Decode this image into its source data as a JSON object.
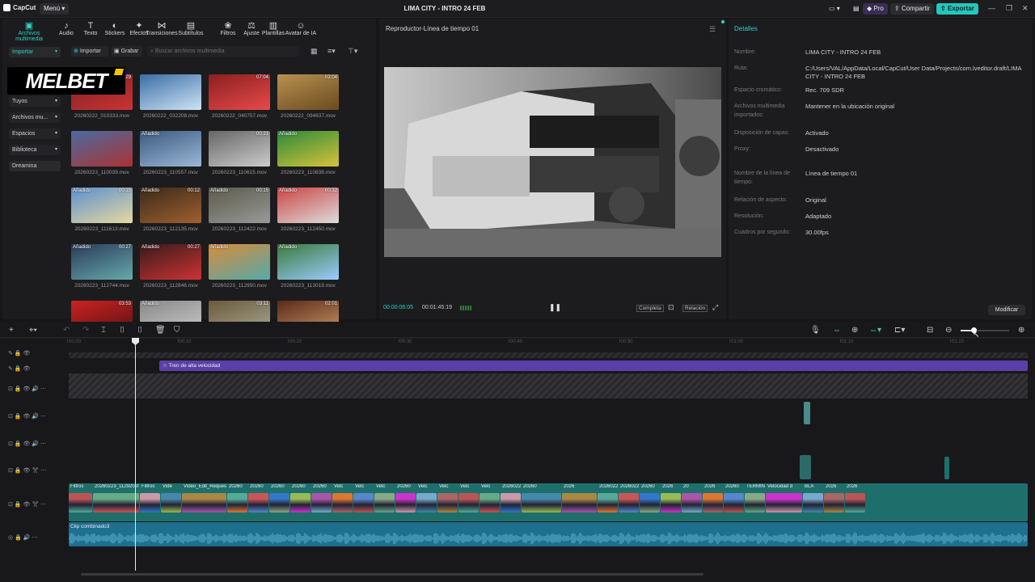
{
  "app": {
    "name": "CapCut",
    "menu_label": "Menú",
    "project_title": "LIMA CITY - INTRO 24 FEB",
    "pro_label": "Pro",
    "share_label": "Compartir",
    "export_label": "Exportar"
  },
  "toolbar": [
    {
      "label": "Archivos multimedia",
      "icon": "media-icon"
    },
    {
      "label": "Audio",
      "icon": "audio-icon"
    },
    {
      "label": "Texto",
      "icon": "text-icon"
    },
    {
      "label": "Stickers",
      "icon": "sticker-icon"
    },
    {
      "label": "Efectos",
      "icon": "effects-icon"
    },
    {
      "label": "Transiciones",
      "icon": "transitions-icon"
    },
    {
      "label": "Subtítulos",
      "icon": "subtitles-icon"
    },
    {
      "label": "Filtros",
      "icon": "filters-icon"
    },
    {
      "label": "Ajuste",
      "icon": "adjust-icon"
    },
    {
      "label": "Plantillas",
      "icon": "templates-icon"
    },
    {
      "label": "Avatar de IA",
      "icon": "ai-avatar-icon"
    }
  ],
  "media": {
    "import_side": "Importar",
    "import_btn": "Importar",
    "record_btn": "Grabar",
    "search_placeholder": "Buscar archivos multimedia",
    "overlay_logo": "MELBET",
    "sidebar": [
      "Tuyos",
      "Archivos mu...",
      "Espacios",
      "Biblioteca",
      "Dreamina"
    ],
    "clips": [
      {
        "name": "20260222_010333.mov",
        "tag": "",
        "dur": ":29"
      },
      {
        "name": "20260222_032208.mov",
        "tag": "",
        "dur": ""
      },
      {
        "name": "20260222_040757.mov",
        "tag": "",
        "dur": "07:04"
      },
      {
        "name": "20260222_094637.mov",
        "tag": "",
        "dur": "02:04"
      },
      {
        "name": "20260223_110039.mov",
        "tag": "",
        "dur": ""
      },
      {
        "name": "20260223_110557.mov",
        "tag": "Añadido",
        "dur": ""
      },
      {
        "name": "20260223_110615.mov",
        "tag": "",
        "dur": "00:21"
      },
      {
        "name": "20260223_110838.mov",
        "tag": "Añadido",
        "dur": ""
      },
      {
        "name": "20260223_111613.mov",
        "tag": "Añadido",
        "dur": "00:15"
      },
      {
        "name": "20260223_112135.mov",
        "tag": "Añadido",
        "dur": "00:12"
      },
      {
        "name": "20260223_112422.mov",
        "tag": "Añadido",
        "dur": "00:15"
      },
      {
        "name": "20260223_112450.mov",
        "tag": "Añadido",
        "dur": "00:32"
      },
      {
        "name": "20260223_112744.mov",
        "tag": "Añadido",
        "dur": "00:27"
      },
      {
        "name": "20260223_112846.mov",
        "tag": "Añadido",
        "dur": "00:27"
      },
      {
        "name": "20260223_112950.mov",
        "tag": "Añadido",
        "dur": ""
      },
      {
        "name": "20260223_113019.mov",
        "tag": "Añadido",
        "dur": ""
      },
      {
        "name": "",
        "tag": "",
        "dur": "03:53"
      },
      {
        "name": "",
        "tag": "Añadido",
        "dur": ""
      },
      {
        "name": "",
        "tag": "",
        "dur": "03:11"
      },
      {
        "name": "",
        "tag": "",
        "dur": "02:01"
      }
    ]
  },
  "player": {
    "title": "Reproductor-Línea de tiempo 01",
    "current": "00:00:06:05",
    "total": "00:01:45:19",
    "full_label": "Completa",
    "ratio_label": "Relación"
  },
  "details": {
    "title": "Detalles",
    "rows": [
      {
        "label": "Nombre:",
        "value": "LIMA CITY - INTRO 24 FEB"
      },
      {
        "label": "Ruta:",
        "value": "C:/Users/VAL/AppData/Local/CapCut/User Data/Projects/com.lveditor.draft/LIMA CITY - INTRO 24 FEB"
      },
      {
        "label": "Espacio cromático:",
        "value": "Rec. 709 SDR"
      },
      {
        "label": "Archivos multimedia importados:",
        "value": "Mantener en la ubicación original"
      },
      {
        "label": "Disposición de capas:",
        "value": "Activado"
      },
      {
        "label": "Proxy:",
        "value": "Desactivado"
      },
      {
        "label": "Nombre de la línea de tiempo:",
        "value": "Línea de tiempo 01"
      },
      {
        "label": "Relación de aspecto:",
        "value": "Original"
      },
      {
        "label": "Resolución:",
        "value": "Adaptado"
      },
      {
        "label": "Cuadros por segundo:",
        "value": "30.00fps"
      }
    ],
    "modify_label": "Modificar"
  },
  "timeline": {
    "ruler": [
      "00:00",
      "00:10",
      "00:20",
      "00:30",
      "00:40",
      "00:50",
      "01:00",
      "01:10",
      "01:20"
    ],
    "effect_clip": "Tren de alta velocidad",
    "audio_clip": "Clip combinado3",
    "main_labels": [
      "Filtros",
      "20260223_112920.m",
      "Filtros",
      "Vide",
      "Video_Edit_Reques",
      "20260",
      "20260",
      "20260",
      "20260",
      "20260",
      "Velc",
      "Velc",
      "Velc",
      "20260",
      "Velc",
      "Velc",
      "Velc",
      "Velc",
      "2026022",
      "20260",
      "2026",
      "20260222",
      "20260224_0312",
      "20260",
      "2026",
      "20",
      "2026",
      "20260",
      "TERMIN",
      "Velocidad d",
      "BLA",
      "2026",
      "2026"
    ],
    "colors": {
      "accent": "#2bd3c7",
      "effect": "#5b3fa8",
      "audio": "#1f6f8f",
      "main_track": "#1e6f6c"
    }
  }
}
